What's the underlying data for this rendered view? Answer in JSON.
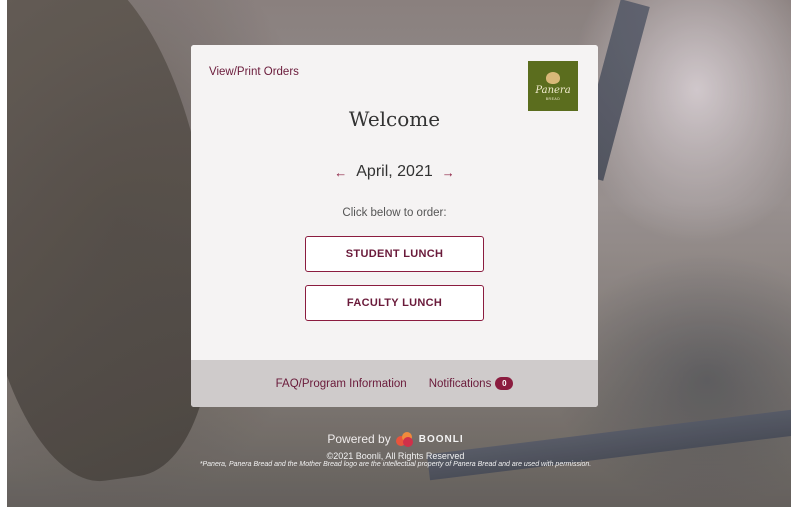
{
  "header": {
    "view_orders_link": "View/Print Orders",
    "logo_text": "Panera",
    "logo_sub": "BREAD"
  },
  "main": {
    "title": "Welcome",
    "month": "April, 2021",
    "prev_arrow": "←",
    "next_arrow": "→",
    "instruction": "Click below to order:",
    "buttons": [
      {
        "label": "STUDENT LUNCH"
      },
      {
        "label": "FACULTY LUNCH"
      }
    ]
  },
  "footer": {
    "faq_link": "FAQ/Program Information",
    "notifications_label": "Notifications",
    "notifications_count": "0"
  },
  "page_footer": {
    "powered_by": "Powered by",
    "brand": "BOONLI",
    "copyright": "©2021 Boonli, All Rights Reserved",
    "legal": "*Panera, Panera Bread and the Mother Bread logo are the intellectual property of Panera Bread and are used with permission."
  },
  "colors": {
    "accent": "#8b1c3f",
    "link_text": "#6a1a3a",
    "logo_bg": "#5b6d1e",
    "card_bg": "#f5f3f3",
    "card_footer_bg": "#cfcbcb"
  },
  "icons": {
    "prev": "arrow-left-icon",
    "next": "arrow-right-icon",
    "brand": "boonli-logo-icon"
  }
}
